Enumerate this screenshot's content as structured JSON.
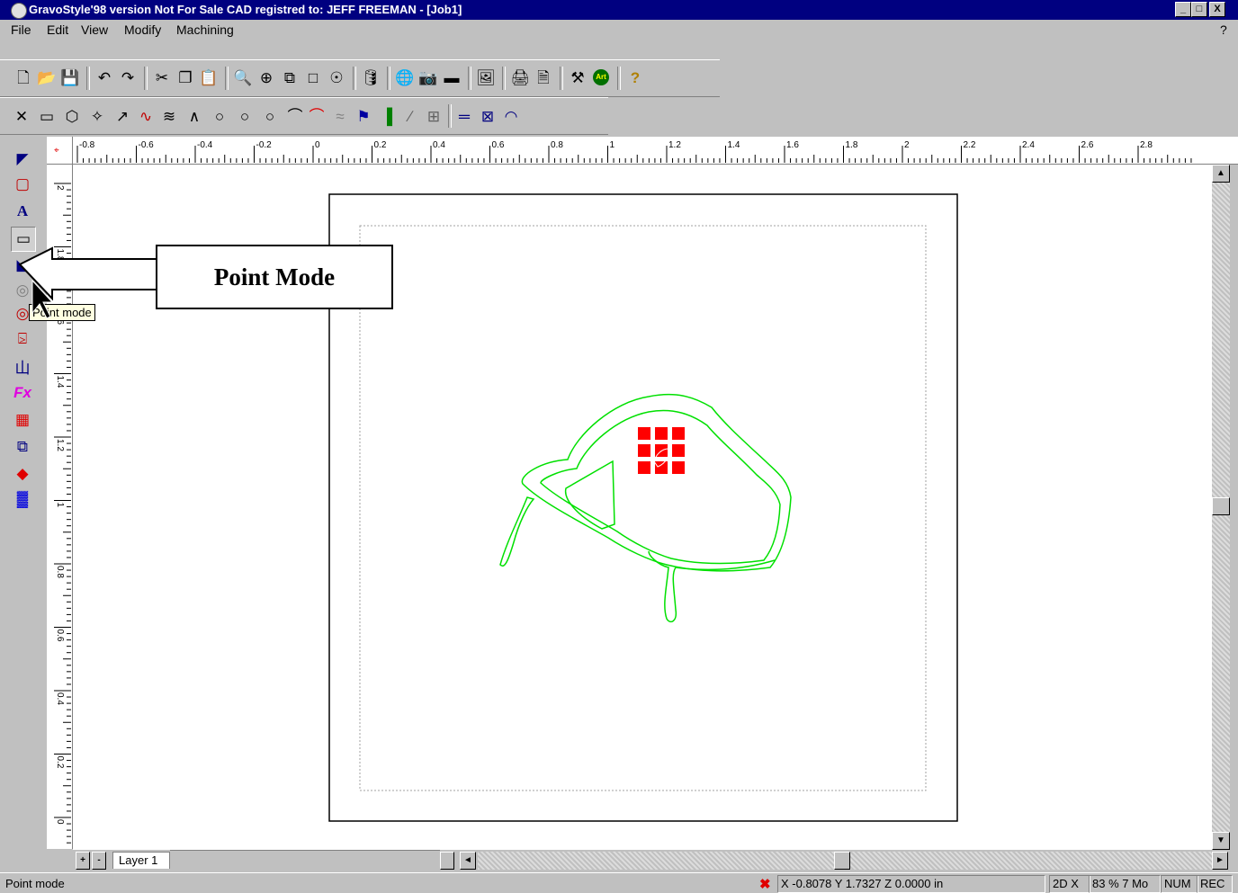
{
  "window": {
    "title": "GravoStyle'98  version Not For Sale CAD registred to: JEFF FREEMAN  - [Job1]",
    "controls": [
      "_",
      "□",
      "X"
    ]
  },
  "menu": {
    "items": [
      "File",
      "Edit",
      "View",
      "Modify",
      "Machining"
    ],
    "help": "?"
  },
  "toolbar_main": {
    "icons": [
      "new-file-icon",
      "open-folder-icon",
      "save-icon",
      "undo-icon",
      "redo-icon",
      "cut-icon",
      "copy-icon",
      "paste-icon",
      "zoom-icon",
      "zoom-in-icon",
      "zoom-window-icon",
      "zoom-page-icon",
      "zoom-all-icon",
      "color-bucket-icon",
      "globe-icon",
      "camera-icon",
      "scanner-icon",
      "layout-icon",
      "print-icon",
      "print-preview-icon",
      "tool-icon",
      "art-icon",
      "help-icon"
    ]
  },
  "toolbar_draw": {
    "icons": [
      "cross-icon",
      "rectangle-icon",
      "polygon-icon",
      "star-icon",
      "arrow-line-icon",
      "curve-icon",
      "freehand-icon",
      "polyline-icon",
      "circle-icon",
      "ellipse-icon",
      "circle3-icon",
      "arc-icon",
      "arc-red-icon",
      "spiral-icon",
      "flag-icon",
      "chart-icon",
      "pen-icon",
      "table-icon",
      "dimension-icon",
      "box-cross-icon",
      "protractor-icon"
    ]
  },
  "left_tools": {
    "icons": [
      "select-arrow-icon",
      "node-edit-icon",
      "text-tool-icon",
      "rectangle-tool-icon",
      "point-mode-icon",
      "weld-icon",
      "combine-icon",
      "clamp-icon",
      "chinese-text-icon",
      "fx-icon",
      "grid-icon",
      "frame-icon",
      "fill-icon",
      "palette-icon"
    ]
  },
  "ruler": {
    "h_labels": [
      "-0.8",
      "-0.6",
      "-0.4",
      "-0.2",
      "0",
      "0.2",
      "0.4",
      "0.6",
      "0.8",
      "1",
      "1.2",
      "1.4",
      "1.6",
      "1.8",
      "2",
      "2.2",
      "2.4",
      "2.6",
      "2.8"
    ],
    "v_labels": [
      "2",
      "1.8",
      "1.6",
      "1.4",
      "1.2",
      "1",
      "0.8",
      "0.6",
      "0.4",
      "0.2",
      "0"
    ]
  },
  "callout": {
    "text": "Point Mode"
  },
  "tooltip": {
    "text": "Point mode"
  },
  "layer_bar": {
    "add": "+",
    "remove": "-",
    "layer_name": "Layer 1"
  },
  "status": {
    "message": "Point mode",
    "coords": "X -0.8078  Y 1.7327  Z 0.0000 in",
    "mode": "2D X",
    "zoom": "83 % 7 Mo",
    "num": "NUM",
    "rec": "REC"
  },
  "colors": {
    "title_bar": "#000080",
    "shape_outline": "#00e000",
    "selection_handles": "#ff0000",
    "tooltip_bg": "#ffffe1"
  }
}
